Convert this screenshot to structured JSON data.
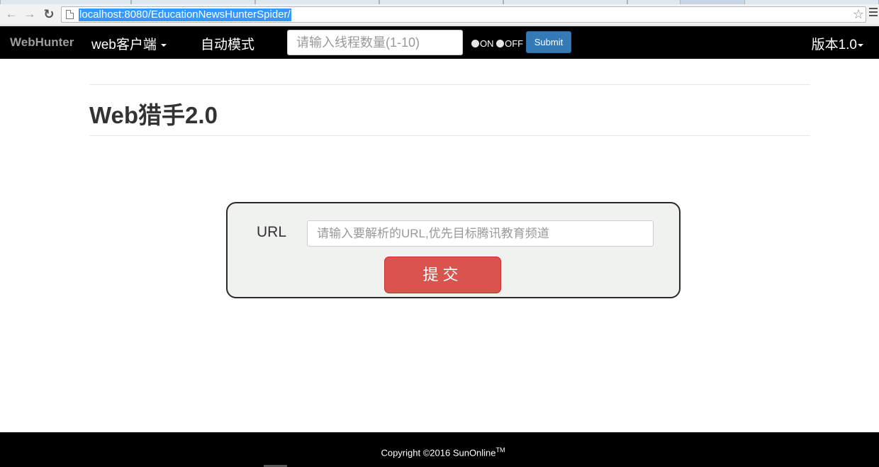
{
  "browser": {
    "url": "localhost:8080/EducationNewsHunterSpider/"
  },
  "navbar": {
    "brand": "WebHunter",
    "web_client": "web客户端",
    "auto_mode": "自动模式",
    "thread_placeholder": "请输入线程数量(1-10)",
    "radio_on": "ON",
    "radio_off": "OFF",
    "submit": "Submit",
    "version": "版本1.0"
  },
  "main": {
    "title": "Web猎手2.0",
    "url_label": "URL",
    "url_placeholder": "请输入要解析的URL,优先目标腾讯教育频道",
    "submit": "提交"
  },
  "footer": {
    "copyright": "Copyright ©2016 SunOnline",
    "trademark": "TM"
  }
}
